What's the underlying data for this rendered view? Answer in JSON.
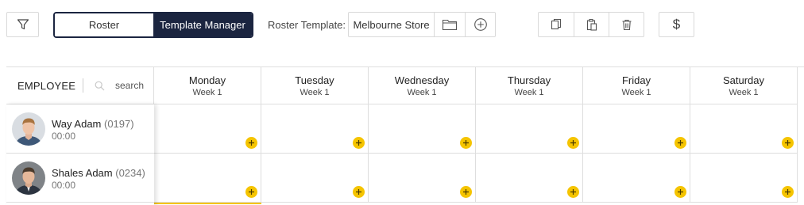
{
  "toolbar": {
    "filter_icon": "filter-icon",
    "view_toggle": [
      {
        "label": "Roster",
        "active": false
      },
      {
        "label": "Template Manager",
        "active": true
      }
    ],
    "template_label": "Roster Template:",
    "template_value": "Melbourne Store",
    "template_icons": [
      "folder-icon",
      "add-circle-icon"
    ],
    "action_icons": [
      "copy-icon",
      "paste-icon",
      "trash-icon"
    ],
    "dollar_label": "$"
  },
  "grid": {
    "employee_header": "EMPLOYEE",
    "search_placeholder": "search",
    "days": [
      {
        "name": "Monday",
        "week": "Week 1"
      },
      {
        "name": "Tuesday",
        "week": "Week 1"
      },
      {
        "name": "Wednesday",
        "week": "Week 1"
      },
      {
        "name": "Thursday",
        "week": "Week 1"
      },
      {
        "name": "Friday",
        "week": "Week 1"
      },
      {
        "name": "Saturday",
        "week": "Week 1"
      }
    ],
    "employees": [
      {
        "name": "Way Adam",
        "code": "(0197)",
        "hours": "00:00"
      },
      {
        "name": "Shales Adam",
        "code": "(0234)",
        "hours": "00:00"
      }
    ]
  },
  "colors": {
    "accent_navy": "#1b2540",
    "add_button": "#f5c400",
    "border": "#dedede"
  }
}
